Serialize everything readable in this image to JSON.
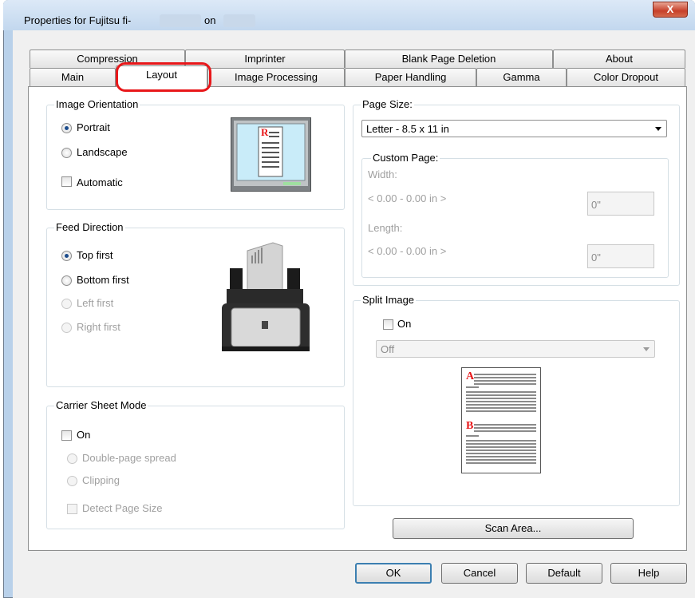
{
  "window": {
    "title": "Properties for Fujitsu fi-",
    "title_on": "on",
    "close_glyph": "X"
  },
  "tabs": {
    "row_back": [
      "Compression",
      "Imprinter",
      "Blank Page Deletion",
      "About"
    ],
    "row_front": [
      "Main",
      "Layout",
      "Image Processing",
      "Paper Handling",
      "Gamma",
      "Color Dropout"
    ],
    "active": "Layout"
  },
  "image_orientation": {
    "title": "Image Orientation",
    "portrait": "Portrait",
    "landscape": "Landscape",
    "automatic": "Automatic",
    "preview_letter": "R"
  },
  "feed_direction": {
    "title": "Feed Direction",
    "options": [
      "Top first",
      "Bottom first",
      "Left first",
      "Right first"
    ]
  },
  "carrier_sheet": {
    "title": "Carrier Sheet Mode",
    "on": "On",
    "double_page": "Double-page spread",
    "clipping": "Clipping",
    "detect_size": "Detect Page Size"
  },
  "page_size": {
    "title": "Page Size:",
    "value": "Letter - 8.5 x 11 in",
    "custom_title": "Custom Page:",
    "width_label": "Width:",
    "width_range": "< 0.00 - 0.00 in >",
    "width_value": "0\"",
    "length_label": "Length:",
    "length_range": "< 0.00 - 0.00 in >",
    "length_value": "0\""
  },
  "split_image": {
    "title": "Split Image",
    "on": "On",
    "value": "Off",
    "marker_a": "A",
    "marker_b": "B"
  },
  "buttons": {
    "scan_area": "Scan Area...",
    "ok": "OK",
    "cancel": "Cancel",
    "default": "Default",
    "help": "Help"
  },
  "colors": {
    "highlight": "#e8171a",
    "close": "#c7402a"
  }
}
